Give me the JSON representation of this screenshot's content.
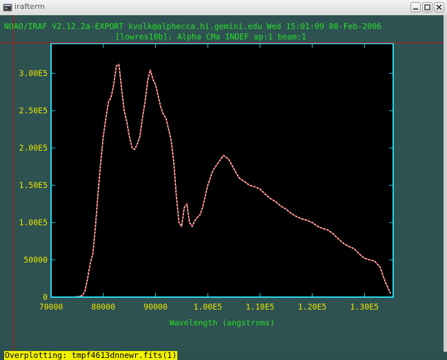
{
  "window": {
    "title": "irafterm"
  },
  "header": {
    "line1": "NOAO/IRAF V2.12.2a-EXPORT kvolk@alphecca.hi.gemini.edu Wed 15:01:09 08-Feb-2006",
    "line2": "[lowres10b]: Alpha CMa INDEF ap:1 beam:1"
  },
  "status": {
    "text": "Overplotting: tmpf4613dnnewr.fits(1)"
  },
  "colors": {
    "background": "#2e5151",
    "frame": "#2ad8ee",
    "tick_labels": "#e8e800",
    "header_text": "#28e028",
    "spectrum_white": "#ffffff",
    "spectrum_red": "#e01818",
    "cursor": "#c81414",
    "status_bg": "#f2f200"
  },
  "chart_data": {
    "type": "line",
    "xlabel": "Wavelength (angstroms)",
    "ylabel": "",
    "xlim": [
      70000,
      135500
    ],
    "ylim": [
      0,
      340000
    ],
    "x_ticks": [
      70000,
      80000,
      90000,
      100000,
      110000,
      120000,
      130000
    ],
    "x_tick_labels": [
      "70000",
      "80000",
      "90000",
      "1.00E5",
      "1.10E5",
      "1.20E5",
      "1.30E5"
    ],
    "y_ticks": [
      0,
      50000,
      100000,
      150000,
      200000,
      250000,
      300000
    ],
    "y_tick_labels": [
      "0",
      "50000",
      "1.00E5",
      "1.50E5",
      "2.00E5",
      "2.50E5",
      "3.00E5"
    ],
    "grid": false,
    "series": [
      {
        "color": "white",
        "x": [
          70000,
          72000,
          74000,
          75000,
          76000,
          76500,
          77000,
          77500,
          78000,
          78500,
          79000,
          79500,
          80000,
          80500,
          81000,
          81500,
          82000,
          82500,
          83000,
          83500,
          84000,
          84500,
          85000,
          85500,
          86000,
          86500,
          87000,
          87500,
          88000,
          88500,
          89000,
          89500,
          90000,
          90500,
          91000,
          91500,
          92000,
          92500,
          93000,
          93500,
          94000,
          94500,
          95000,
          95500,
          96000,
          96500,
          97000,
          97500,
          98000,
          98500,
          99000,
          99500,
          100000,
          101000,
          102000,
          103000,
          104000,
          105000,
          106000,
          107000,
          108000,
          109000,
          110000,
          111000,
          112000,
          113000,
          114000,
          115000,
          116000,
          117000,
          118000,
          119000,
          120000,
          121000,
          122000,
          123000,
          124000,
          125000,
          126000,
          127000,
          128000,
          129000,
          130000,
          131000,
          132000,
          133000,
          134000,
          135000
        ],
        "y": [
          0,
          0,
          0,
          500,
          2000,
          8000,
          25000,
          45000,
          58000,
          95000,
          140000,
          180000,
          215000,
          240000,
          262000,
          268000,
          285000,
          310000,
          312000,
          280000,
          250000,
          235000,
          215000,
          200000,
          198000,
          205000,
          215000,
          240000,
          262000,
          290000,
          305000,
          292000,
          285000,
          270000,
          255000,
          245000,
          240000,
          225000,
          210000,
          180000,
          135000,
          100000,
          95000,
          120000,
          125000,
          100000,
          95000,
          102000,
          107000,
          110000,
          120000,
          135000,
          150000,
          170000,
          180000,
          190000,
          185000,
          172000,
          160000,
          155000,
          150000,
          148000,
          145000,
          138000,
          132000,
          128000,
          122000,
          118000,
          112000,
          108000,
          105000,
          103000,
          100000,
          95000,
          92000,
          90000,
          85000,
          78000,
          72000,
          68000,
          65000,
          58000,
          52000,
          50000,
          48000,
          40000,
          20000,
          5000
        ]
      },
      {
        "color": "red",
        "x": [
          70000,
          72000,
          74000,
          75000,
          76000,
          76500,
          77000,
          77500,
          78000,
          78500,
          79000,
          79500,
          80000,
          80500,
          81000,
          81500,
          82000,
          82500,
          83000,
          83500,
          84000,
          84500,
          85000,
          85500,
          86000,
          86500,
          87000,
          87500,
          88000,
          88500,
          89000,
          89500,
          90000,
          90500,
          91000,
          91500,
          92000,
          92500,
          93000,
          93500,
          94000,
          94500,
          95000,
          95500,
          96000,
          96500,
          97000,
          97500,
          98000,
          98500,
          99000,
          99500,
          100000,
          101000,
          102000,
          103000,
          104000,
          105000,
          106000,
          107000,
          108000,
          109000,
          110000,
          111000,
          112000,
          113000,
          114000,
          115000,
          116000,
          117000,
          118000,
          119000,
          120000,
          121000,
          122000,
          123000,
          124000,
          125000,
          126000,
          127000,
          128000,
          129000,
          130000,
          131000,
          132000,
          133000,
          134000,
          135000
        ],
        "y": [
          0,
          0,
          0,
          500,
          2000,
          8000,
          25000,
          45000,
          58000,
          95000,
          140000,
          180000,
          215000,
          240000,
          262000,
          268000,
          285000,
          310000,
          312000,
          280000,
          250000,
          235000,
          215000,
          200000,
          198000,
          205000,
          215000,
          240000,
          262000,
          290000,
          305000,
          292000,
          285000,
          270000,
          255000,
          245000,
          240000,
          225000,
          210000,
          180000,
          135000,
          100000,
          95000,
          120000,
          125000,
          100000,
          95000,
          102000,
          107000,
          110000,
          120000,
          135000,
          150000,
          170000,
          180000,
          190000,
          185000,
          172000,
          160000,
          155000,
          150000,
          148000,
          145000,
          138000,
          132000,
          128000,
          122000,
          118000,
          112000,
          108000,
          105000,
          103000,
          100000,
          95000,
          92000,
          90000,
          85000,
          78000,
          72000,
          68000,
          65000,
          58000,
          52000,
          50000,
          48000,
          40000,
          20000,
          5000
        ]
      }
    ]
  }
}
